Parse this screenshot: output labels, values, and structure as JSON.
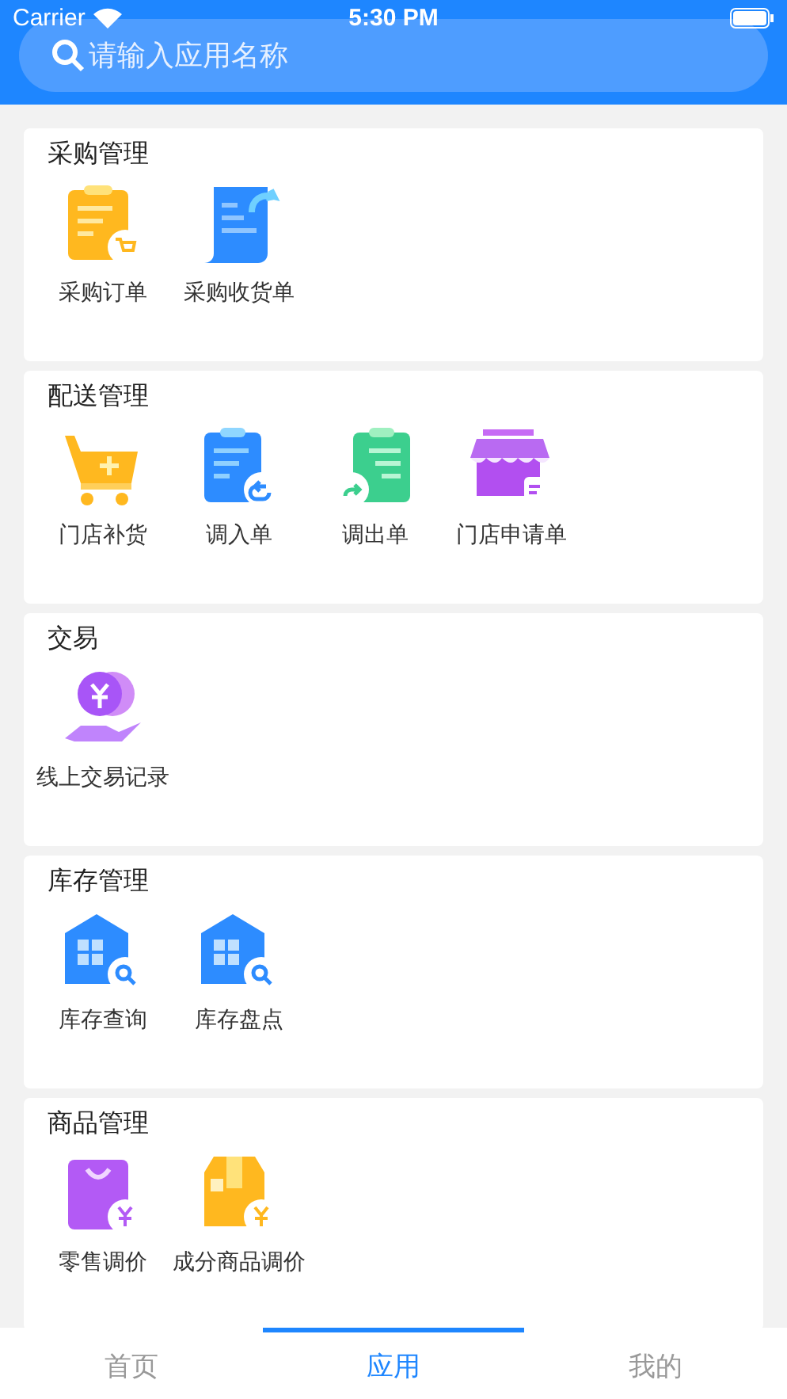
{
  "status_bar": {
    "carrier": "Carrier",
    "time": "5:30 PM"
  },
  "search": {
    "placeholder": "请输入应用名称"
  },
  "sections": [
    {
      "title": "采购管理",
      "apps": [
        {
          "label": "采购订单",
          "kind": "order"
        },
        {
          "label": "采购收货单",
          "kind": "receipt"
        }
      ]
    },
    {
      "title": "配送管理",
      "apps": [
        {
          "label": "门店补货",
          "kind": "cart"
        },
        {
          "label": "调入单",
          "kind": "transfer-in"
        },
        {
          "label": "调出单",
          "kind": "transfer-out"
        },
        {
          "label": "门店申请单",
          "kind": "store"
        }
      ]
    },
    {
      "title": "交易",
      "apps": [
        {
          "label": "线上交易记录",
          "kind": "coins"
        }
      ]
    },
    {
      "title": "库存管理",
      "apps": [
        {
          "label": "库存查询",
          "kind": "stock"
        },
        {
          "label": "库存盘点",
          "kind": "stock"
        }
      ]
    },
    {
      "title": "商品管理",
      "apps": [
        {
          "label": "零售调价",
          "kind": "bag"
        },
        {
          "label": "成分商品调价",
          "kind": "box"
        }
      ]
    }
  ],
  "tabs": [
    {
      "label": "首页",
      "selected": false
    },
    {
      "label": "应用",
      "selected": true
    },
    {
      "label": "我的",
      "selected": false
    }
  ]
}
